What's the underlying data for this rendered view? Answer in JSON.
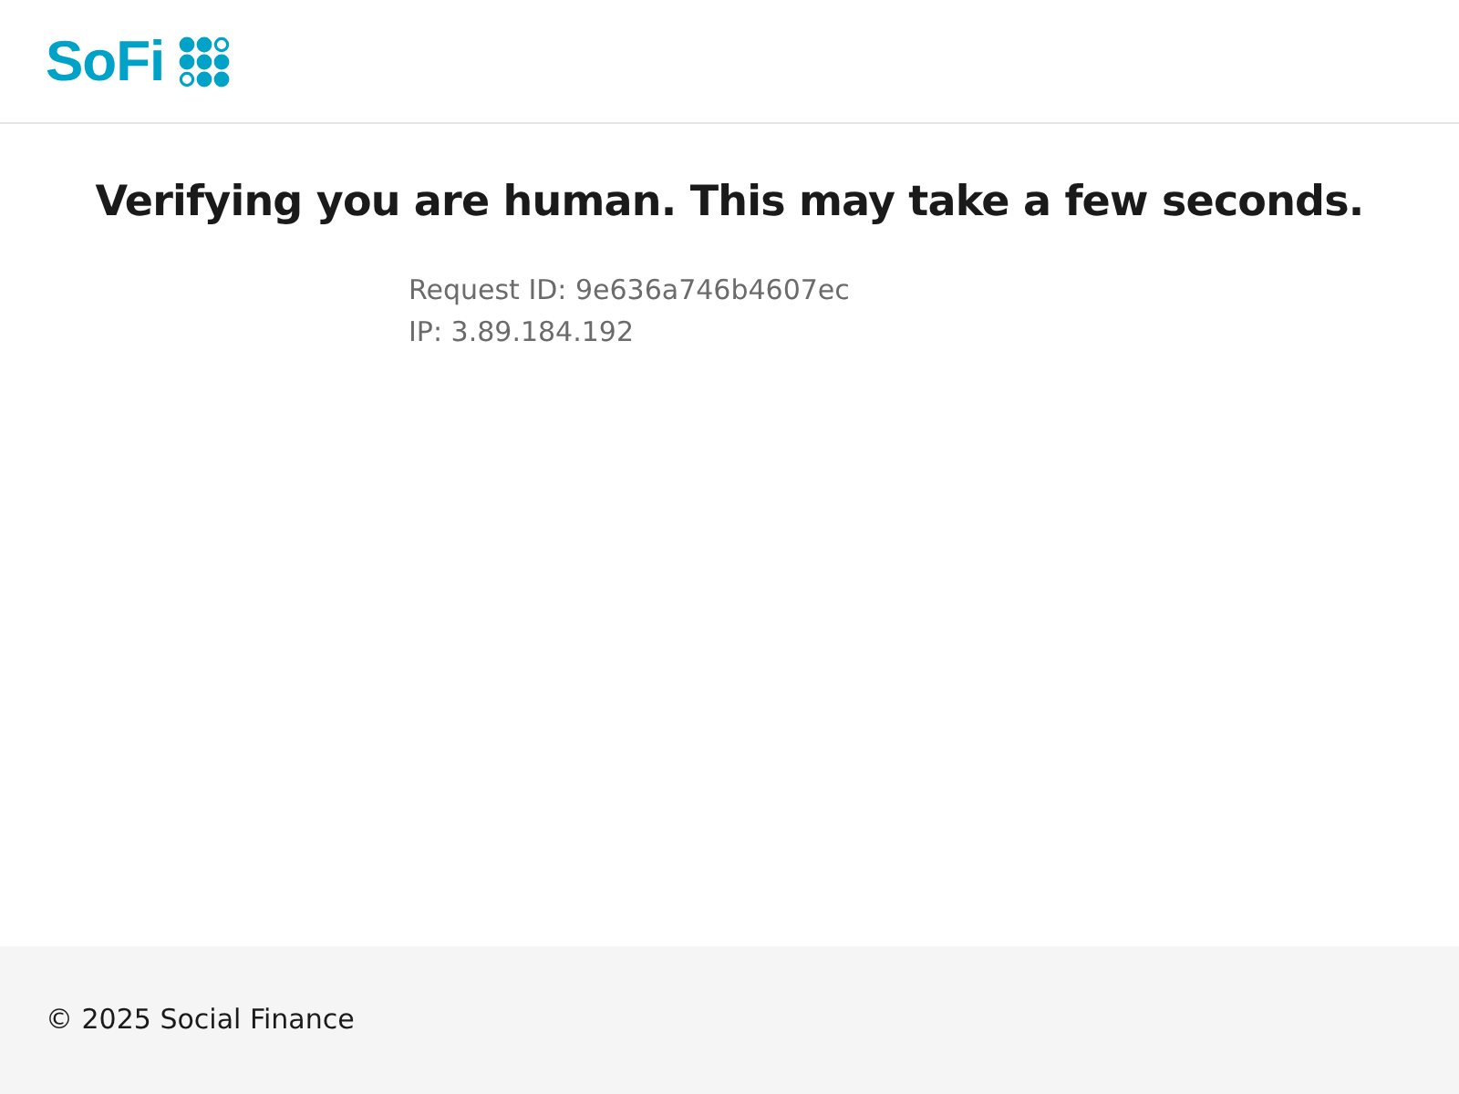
{
  "header": {
    "logo": "SoFi"
  },
  "main": {
    "heading": "Verifying you are human. This may take a few seconds.",
    "details": [
      "Request ID: 9e636a746b4607ec",
      "IP: 3.89.184.192"
    ]
  },
  "footer": {
    "copyright": "© 2025 Social Finance"
  }
}
